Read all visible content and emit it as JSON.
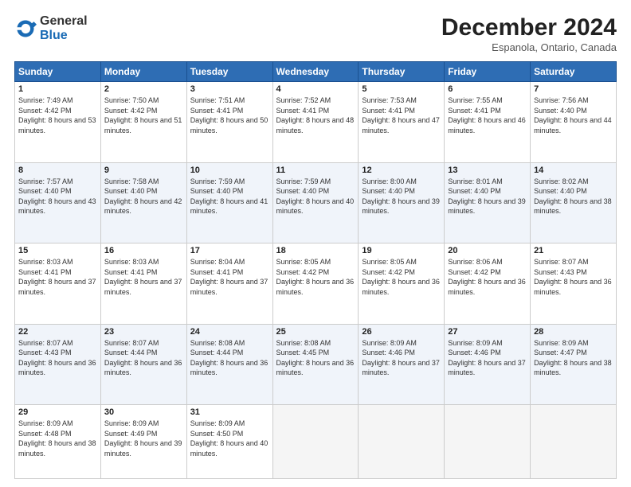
{
  "header": {
    "logo_line1": "General",
    "logo_line2": "Blue",
    "month_year": "December 2024",
    "location": "Espanola, Ontario, Canada"
  },
  "weekdays": [
    "Sunday",
    "Monday",
    "Tuesday",
    "Wednesday",
    "Thursday",
    "Friday",
    "Saturday"
  ],
  "weeks": [
    [
      {
        "day": "1",
        "sunrise": "7:49 AM",
        "sunset": "4:42 PM",
        "daylight": "8 hours and 53 minutes."
      },
      {
        "day": "2",
        "sunrise": "7:50 AM",
        "sunset": "4:42 PM",
        "daylight": "8 hours and 51 minutes."
      },
      {
        "day": "3",
        "sunrise": "7:51 AM",
        "sunset": "4:41 PM",
        "daylight": "8 hours and 50 minutes."
      },
      {
        "day": "4",
        "sunrise": "7:52 AM",
        "sunset": "4:41 PM",
        "daylight": "8 hours and 48 minutes."
      },
      {
        "day": "5",
        "sunrise": "7:53 AM",
        "sunset": "4:41 PM",
        "daylight": "8 hours and 47 minutes."
      },
      {
        "day": "6",
        "sunrise": "7:55 AM",
        "sunset": "4:41 PM",
        "daylight": "8 hours and 46 minutes."
      },
      {
        "day": "7",
        "sunrise": "7:56 AM",
        "sunset": "4:40 PM",
        "daylight": "8 hours and 44 minutes."
      }
    ],
    [
      {
        "day": "8",
        "sunrise": "7:57 AM",
        "sunset": "4:40 PM",
        "daylight": "8 hours and 43 minutes."
      },
      {
        "day": "9",
        "sunrise": "7:58 AM",
        "sunset": "4:40 PM",
        "daylight": "8 hours and 42 minutes."
      },
      {
        "day": "10",
        "sunrise": "7:59 AM",
        "sunset": "4:40 PM",
        "daylight": "8 hours and 41 minutes."
      },
      {
        "day": "11",
        "sunrise": "7:59 AM",
        "sunset": "4:40 PM",
        "daylight": "8 hours and 40 minutes."
      },
      {
        "day": "12",
        "sunrise": "8:00 AM",
        "sunset": "4:40 PM",
        "daylight": "8 hours and 39 minutes."
      },
      {
        "day": "13",
        "sunrise": "8:01 AM",
        "sunset": "4:40 PM",
        "daylight": "8 hours and 39 minutes."
      },
      {
        "day": "14",
        "sunrise": "8:02 AM",
        "sunset": "4:40 PM",
        "daylight": "8 hours and 38 minutes."
      }
    ],
    [
      {
        "day": "15",
        "sunrise": "8:03 AM",
        "sunset": "4:41 PM",
        "daylight": "8 hours and 37 minutes."
      },
      {
        "day": "16",
        "sunrise": "8:03 AM",
        "sunset": "4:41 PM",
        "daylight": "8 hours and 37 minutes."
      },
      {
        "day": "17",
        "sunrise": "8:04 AM",
        "sunset": "4:41 PM",
        "daylight": "8 hours and 37 minutes."
      },
      {
        "day": "18",
        "sunrise": "8:05 AM",
        "sunset": "4:42 PM",
        "daylight": "8 hours and 36 minutes."
      },
      {
        "day": "19",
        "sunrise": "8:05 AM",
        "sunset": "4:42 PM",
        "daylight": "8 hours and 36 minutes."
      },
      {
        "day": "20",
        "sunrise": "8:06 AM",
        "sunset": "4:42 PM",
        "daylight": "8 hours and 36 minutes."
      },
      {
        "day": "21",
        "sunrise": "8:07 AM",
        "sunset": "4:43 PM",
        "daylight": "8 hours and 36 minutes."
      }
    ],
    [
      {
        "day": "22",
        "sunrise": "8:07 AM",
        "sunset": "4:43 PM",
        "daylight": "8 hours and 36 minutes."
      },
      {
        "day": "23",
        "sunrise": "8:07 AM",
        "sunset": "4:44 PM",
        "daylight": "8 hours and 36 minutes."
      },
      {
        "day": "24",
        "sunrise": "8:08 AM",
        "sunset": "4:44 PM",
        "daylight": "8 hours and 36 minutes."
      },
      {
        "day": "25",
        "sunrise": "8:08 AM",
        "sunset": "4:45 PM",
        "daylight": "8 hours and 36 minutes."
      },
      {
        "day": "26",
        "sunrise": "8:09 AM",
        "sunset": "4:46 PM",
        "daylight": "8 hours and 37 minutes."
      },
      {
        "day": "27",
        "sunrise": "8:09 AM",
        "sunset": "4:46 PM",
        "daylight": "8 hours and 37 minutes."
      },
      {
        "day": "28",
        "sunrise": "8:09 AM",
        "sunset": "4:47 PM",
        "daylight": "8 hours and 38 minutes."
      }
    ],
    [
      {
        "day": "29",
        "sunrise": "8:09 AM",
        "sunset": "4:48 PM",
        "daylight": "8 hours and 38 minutes."
      },
      {
        "day": "30",
        "sunrise": "8:09 AM",
        "sunset": "4:49 PM",
        "daylight": "8 hours and 39 minutes."
      },
      {
        "day": "31",
        "sunrise": "8:09 AM",
        "sunset": "4:50 PM",
        "daylight": "8 hours and 40 minutes."
      },
      null,
      null,
      null,
      null
    ]
  ]
}
